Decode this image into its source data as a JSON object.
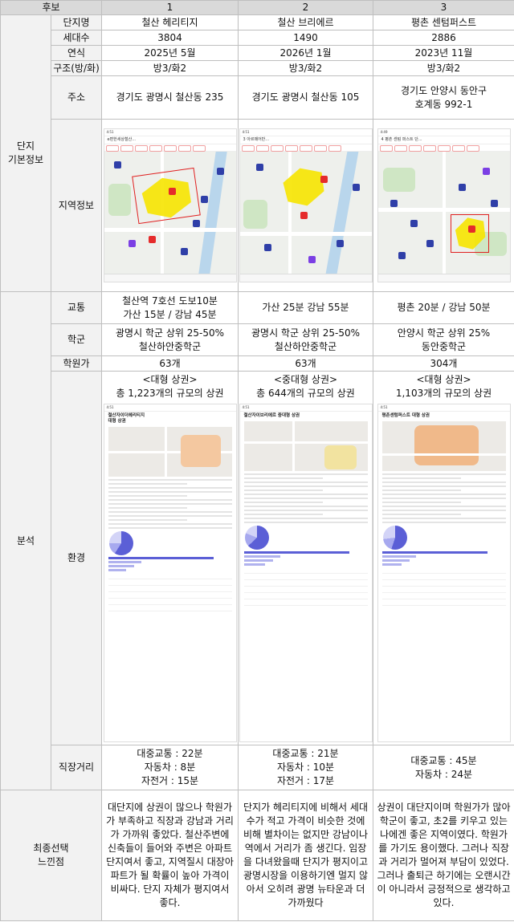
{
  "header": {
    "label": "후보",
    "c1": "1",
    "c2": "2",
    "c3": "3"
  },
  "sections": {
    "basic": "단지\n기본정보",
    "analysis": "분석",
    "final": "최종선택\n느낀점"
  },
  "rows": {
    "name": {
      "label": "단지명",
      "v1": "철산 헤리티지",
      "v2": "철산 브리에르",
      "v3": "평촌 센텀퍼스트"
    },
    "units": {
      "label": "세대수",
      "v1": "3804",
      "v2": "1490",
      "v3": "2886"
    },
    "year": {
      "label": "연식",
      "v1": "2025년 5월",
      "v2": "2026년 1월",
      "v3": "2023년 11월"
    },
    "structure": {
      "label": "구조(방/화)",
      "v1": "방3/화2",
      "v2": "방3/화2",
      "v3": "방3/화2"
    },
    "address": {
      "label": "주소",
      "v1": "경기도 광명시 철산동 235",
      "v2": "경기도 광명시 철산동 105",
      "v3": "경기도 안양시 동안구\n호계동 992-1"
    },
    "region": {
      "label": "지역정보"
    },
    "transport": {
      "label": "교통",
      "v1": "철산역 7호선 도보10분\n가산 15분 / 강남 45분",
      "v2": "가산 25분 강남 55분",
      "v3": "평촌 20분 / 강남 50분"
    },
    "school": {
      "label": "학군",
      "v1": "광명시 학군 상위 25-50%\n철산하안중학군",
      "v2": "광명시 학군 상위 25-50%\n철산하안중학군",
      "v3": "안양시 학군 상위 25%\n동안중학군"
    },
    "academy": {
      "label": "학원가",
      "v1": "63개",
      "v2": "63개",
      "v3": "304개"
    },
    "environment": {
      "label": "환경",
      "v1": "<대형 상권>\n총 1,223개의 규모의 상권",
      "v2": "<중대형 상권>\n총 644개의 규모의 상권",
      "v3": "<대형 상권>\n1,103개의 규모의 상권"
    },
    "commute": {
      "label": "직장거리",
      "v1": "대중교통 : 22분\n자동차 : 8분\n자전거 : 15분",
      "v2": "대중교통 : 21분\n자동차 : 10분\n자전거 : 17분",
      "v3": "대중교통 : 45분\n자동차 : 24분"
    },
    "feeling": {
      "v1": "대단지에 상권이 많으나 학원가가 부족하고 직장과 강남과 거리가 가까워 좋았다. 철산주변에 신축들이 들어와 주변은 아파트단지여서 좋고, 지역질시 대장아파트가 될 확률이 높아 가격이 비싸다. 단지 자체가 평지여서 좋다.",
      "v2": "단지가 헤리티지에 비해서 세대수가 적고 가격이 비슷한 것에 비해 별차이는 없지만 강남이나 역에서 거리가 좀 생긴다. 임장을 다녀왔을때 단지가 평지이고 광명시장을 이용하기엔 멀지 않아서 오히려 광명 뉴타운과 더 가까웠다",
      "v3": "상권이 대단지이며 학원가가 많아 학군이 좋고, 초2를 키우고 있는 나에겐 좋은 지역이였다. 학원가를 가기도 용이했다. 그러나 직장과 거리가 멀어져 부담이 있었다. 그러나 출퇴근 하기에는 오랜시간이 아니라서 긍정적으로 생각하고 있다."
    }
  },
  "screens": {
    "map1_title": "e편한세상철산...",
    "map2_title": "3 아르떼어반...",
    "map3_title": "4 평촌 센텀 퍼스트 단...",
    "sg1_title": "철산자이더헤리티지\n대형 상권",
    "sg2_title": "철산자이브리에르 중대형 상권",
    "sg3_title": "평촌센텀퍼스트 대형 상권",
    "colors": {
      "yellow": "#f6e400",
      "outline": "#e02020",
      "pin_blue": "#2f3fa8",
      "pin_red": "#e52b2b",
      "donut": "#5b5fd6"
    }
  }
}
